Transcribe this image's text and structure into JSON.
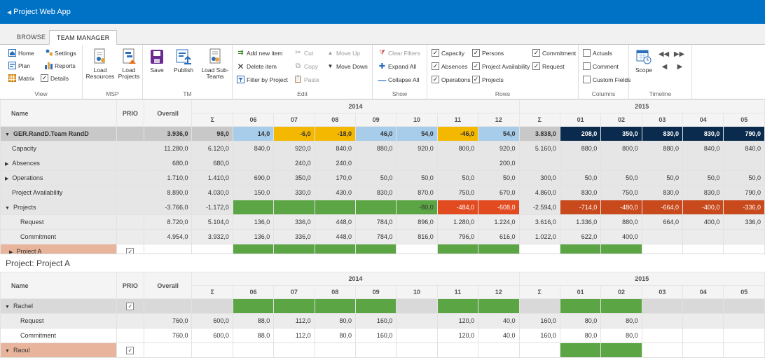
{
  "app": {
    "title": "Project Web App"
  },
  "tabs": [
    "BROWSE",
    "TEAM MANAGER"
  ],
  "ribbon": {
    "view": {
      "label": "View",
      "home": "Home",
      "settings": "Settings",
      "plan": "Plan",
      "reports": "Reports",
      "matrix": "Matrix",
      "details": "Details"
    },
    "msp": {
      "label": "MSP",
      "load_resources": "Load Resources",
      "load_projects": "Load Projects"
    },
    "tm": {
      "label": "TM",
      "save": "Save",
      "publish": "Publish",
      "load_subteams": "Load Sub-Teams"
    },
    "edit": {
      "label": "Edit",
      "add_new_item": "Add new item",
      "delete_item": "Delete item",
      "filter_by_project": "Filter by Project",
      "cut": "Cut",
      "copy": "Copy",
      "paste": "Paste",
      "move_up": "Move Up",
      "move_down": "Move Down"
    },
    "show": {
      "label": "Show",
      "clear_filters": "Clear Filters",
      "expand_all": "Expand All",
      "collapse_all": "Collapse All"
    },
    "rows": {
      "label": "Rows",
      "capacity": "Capacity",
      "persons": "Persons",
      "commitment": "Commitment",
      "absences": "Absences",
      "project_availability": "Project Availability",
      "request": "Request",
      "operations": "Operations",
      "projects": "Projects"
    },
    "columns": {
      "label": "Columns",
      "actuals": "Actuals",
      "comment": "Comment",
      "custom_fields": "Custom Fields"
    },
    "timeline": {
      "label": "Timeline",
      "scope": "Scope"
    }
  },
  "grid_headers": {
    "name": "Name",
    "prio": "PRIO",
    "overall": "Overall",
    "year1": "2014",
    "year2": "2015",
    "cols": [
      "Σ",
      "06",
      "07",
      "08",
      "09",
      "10",
      "11",
      "12",
      "Σ",
      "01",
      "02",
      "03",
      "04",
      "05"
    ]
  },
  "team_grid": {
    "rows": [
      {
        "name": "GER.RandD.Team RandD",
        "overall": "3.936,0",
        "cells": [
          "98,0",
          "14,0",
          "-6,0",
          "-18,0",
          "46,0",
          "54,0",
          "-46,0",
          "54,0",
          "3.838,0",
          "208,0",
          "350,0",
          "830,0",
          "830,0",
          "790,0"
        ]
      },
      {
        "name": "Capacity",
        "overall": "11.280,0",
        "cells": [
          "6.120,0",
          "840,0",
          "920,0",
          "840,0",
          "880,0",
          "920,0",
          "800,0",
          "920,0",
          "5.160,0",
          "880,0",
          "800,0",
          "880,0",
          "840,0",
          "840,0"
        ]
      },
      {
        "name": "Absences",
        "overall": "680,0",
        "cells": [
          "680,0",
          "",
          "240,0",
          "240,0",
          "",
          "",
          "",
          "200,0",
          "",
          "",
          "",
          "",
          "",
          ""
        ]
      },
      {
        "name": "Operations",
        "overall": "1.710,0",
        "cells": [
          "1.410,0",
          "690,0",
          "350,0",
          "170,0",
          "50,0",
          "50,0",
          "50,0",
          "50,0",
          "300,0",
          "50,0",
          "50,0",
          "50,0",
          "50,0",
          "50,0"
        ]
      },
      {
        "name": "Project Availability",
        "overall": "8.890,0",
        "cells": [
          "4.030,0",
          "150,0",
          "330,0",
          "430,0",
          "830,0",
          "870,0",
          "750,0",
          "670,0",
          "4.860,0",
          "830,0",
          "750,0",
          "830,0",
          "830,0",
          "790,0"
        ]
      },
      {
        "name": "Projects",
        "overall": "-3.766,0",
        "cells": [
          "-1.172,0",
          "",
          "",
          "",
          "",
          "-80,0",
          "-484,0",
          "-608,0",
          "-2.594,0",
          "-714,0",
          "-480,0",
          "-664,0",
          "-400,0",
          "-336,0"
        ]
      },
      {
        "name": "Request",
        "overall": "8.720,0",
        "cells": [
          "5.104,0",
          "136,0",
          "336,0",
          "448,0",
          "784,0",
          "896,0",
          "1.280,0",
          "1.224,0",
          "3.616,0",
          "1.336,0",
          "880,0",
          "664,0",
          "400,0",
          "336,0"
        ]
      },
      {
        "name": "Commitment",
        "overall": "4.954,0",
        "cells": [
          "3.932,0",
          "136,0",
          "336,0",
          "448,0",
          "784,0",
          "816,0",
          "796,0",
          "616,0",
          "1.022,0",
          "622,0",
          "400,0",
          "",
          "",
          ""
        ]
      },
      {
        "name": "Project A",
        "overall": "",
        "cells": [
          "",
          "",
          "",
          "",
          "",
          "",
          "",
          "",
          "",
          "",
          "",
          "",
          "",
          ""
        ]
      }
    ]
  },
  "project_section": {
    "title": "Project: Project A"
  },
  "project_grid": {
    "rows": [
      {
        "name": "Rachel",
        "overall": "",
        "cells": [
          "",
          "",
          "",
          "",
          "",
          "",
          "",
          "",
          "",
          "",
          "",
          "",
          "",
          ""
        ]
      },
      {
        "name": "Request",
        "overall": "760,0",
        "cells": [
          "600,0",
          "88,0",
          "112,0",
          "80,0",
          "160,0",
          "",
          "120,0",
          "40,0",
          "160,0",
          "80,0",
          "80,0",
          "",
          "",
          ""
        ]
      },
      {
        "name": "Commitment",
        "overall": "760,0",
        "cells": [
          "600,0",
          "88,0",
          "112,0",
          "80,0",
          "160,0",
          "",
          "120,0",
          "40,0",
          "160,0",
          "80,0",
          "80,0",
          "",
          "",
          ""
        ]
      },
      {
        "name": "Raoul",
        "overall": "",
        "cells": [
          "",
          "",
          "",
          "",
          "",
          "",
          "",
          "",
          "",
          "",
          "",
          "",
          "",
          ""
        ]
      }
    ]
  },
  "colors": {
    "suite_bar": "#0072c6",
    "green": "#5ba544",
    "red": "#e24a1f",
    "navy": "#0a2a4e",
    "yellow": "#f4b800",
    "light_blue": "#a7cdea",
    "pink": "#e8b49b"
  }
}
